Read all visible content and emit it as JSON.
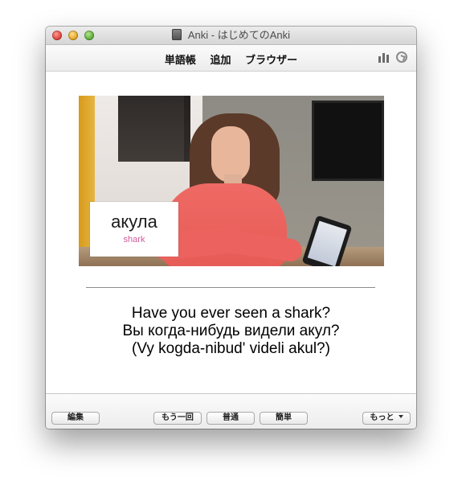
{
  "window": {
    "title": "Anki - はじめてのAnki"
  },
  "toolbar": {
    "nav_items": [
      "単語帳",
      "追加",
      "ブラウザー"
    ],
    "icons": {
      "stats": "stats-icon",
      "sync": "sync-icon"
    }
  },
  "card": {
    "video": {
      "caption_word": "акула",
      "caption_translation": "shark"
    },
    "answer_lines": [
      "Have you ever seen a shark?",
      "Вы когда-нибудь видели акул?",
      "(Vy kogda-nibud' videli akul?)"
    ]
  },
  "footer": {
    "edit_label": "編集",
    "answer_buttons": [
      "もう一回",
      "普通",
      "簡単"
    ],
    "more_label": "もっと"
  },
  "colors": {
    "caption_translation": "#d05c99",
    "answer_text": "#000000"
  }
}
